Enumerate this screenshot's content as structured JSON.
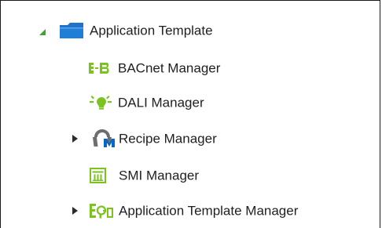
{
  "tree": {
    "root": {
      "label": "Application Template",
      "expanded": true,
      "icon": "folder-icon"
    },
    "children": [
      {
        "label": "BACnet Manager",
        "icon": "bacnet-icon",
        "expandable": false
      },
      {
        "label": "DALI Manager",
        "icon": "dali-lightbulb-icon",
        "expandable": false
      },
      {
        "label": "Recipe Manager",
        "icon": "recipe-icon",
        "expandable": true
      },
      {
        "label": "SMI Manager",
        "icon": "smi-icon",
        "expandable": false
      },
      {
        "label": "Application Template Manager",
        "icon": "application-template-manager-icon",
        "expandable": true
      }
    ]
  },
  "colors": {
    "folder_blue": "#1e72c9",
    "expanded_triangle": "#3fa33a",
    "collapsed_triangle": "#2b2b2b",
    "green_icon": "#7bc41f",
    "recipe_gray": "#6e6e6e",
    "recipe_blue": "#0a66c2"
  }
}
